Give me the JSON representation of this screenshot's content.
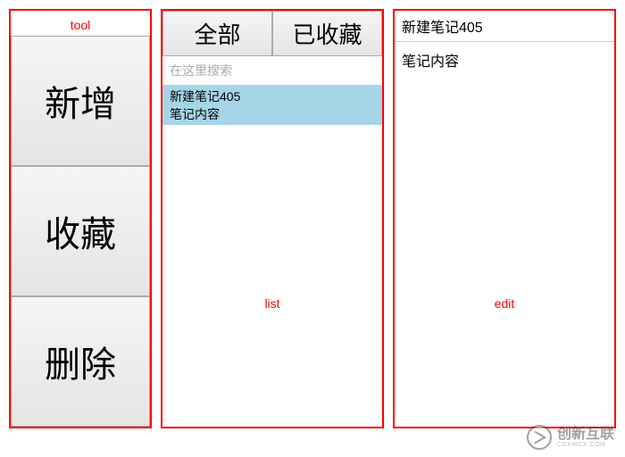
{
  "tool": {
    "label": "tool",
    "buttons": {
      "add": "新增",
      "favorite": "收藏",
      "delete": "删除"
    }
  },
  "list": {
    "label": "list",
    "tabs": {
      "all": "全部",
      "favorited": "已收藏"
    },
    "search_placeholder": "在这里搜索",
    "items": [
      {
        "title": "新建笔记405",
        "preview": "笔记内容"
      }
    ]
  },
  "edit": {
    "label": "edit",
    "title": "新建笔记405",
    "content": "笔记内容"
  },
  "watermark": {
    "main": "创新互联",
    "sub": "CDXWCX.COM"
  }
}
